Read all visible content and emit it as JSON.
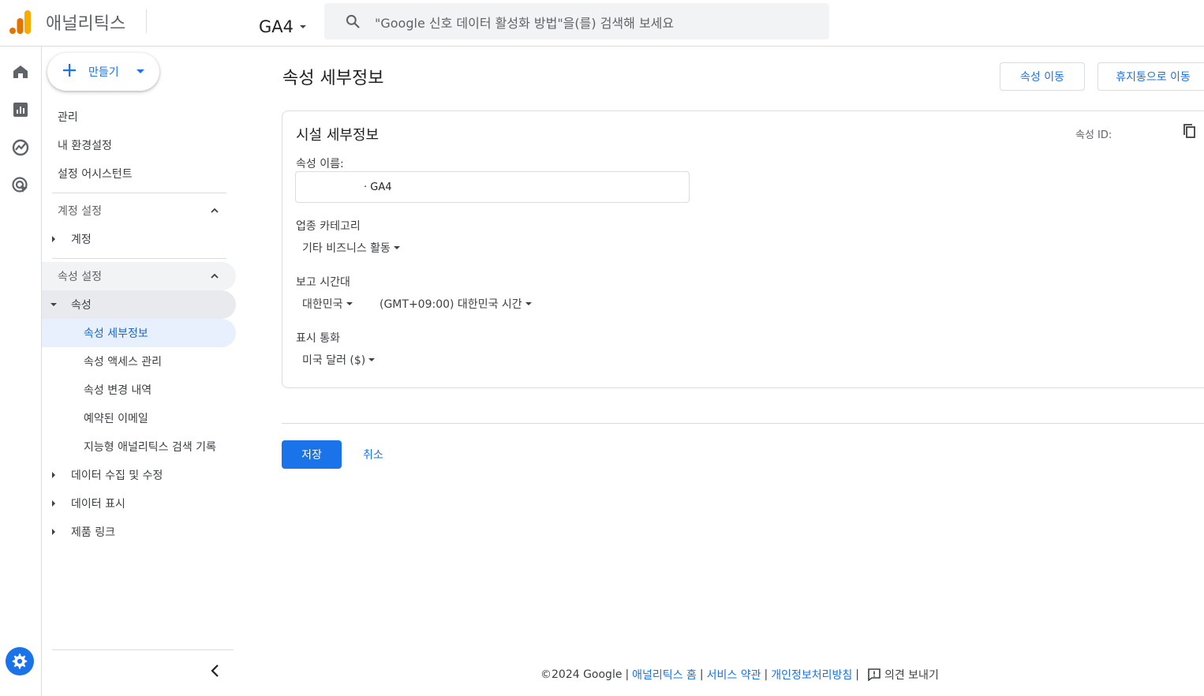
{
  "header": {
    "app_name": "애널리틱스",
    "property_name": "GA4",
    "search_placeholder": "\"Google 신호 데이터 활성화 방법\"을(를) 검색해 보세요"
  },
  "rail": {
    "items": [
      "home-icon",
      "reports-icon",
      "explore-icon",
      "advertising-icon"
    ],
    "settings": "gear-icon"
  },
  "sidenav": {
    "create_label": "만들기",
    "admin": "관리",
    "my_preferences": "내 환경설정",
    "setup_assistant": "설정 어시스턴트",
    "account_settings_header": "계정 설정",
    "account": "계정",
    "property_settings_header": "속성 설정",
    "property": "속성",
    "property_details": "속성 세부정보",
    "property_access": "속성 액세스 관리",
    "property_change_history": "속성 변경 내역",
    "scheduled_emails": "예약된 이메일",
    "analytics_search_history": "지능형 애널리틱스 검색 기록",
    "data_collection": "데이터 수집 및 수정",
    "data_display": "데이터 표시",
    "product_links": "제품 링크"
  },
  "main": {
    "page_title": "속성 세부정보",
    "move_property": "속성 이동",
    "move_to_trash": "휴지통으로 이동",
    "card_title": "시설 세부정보",
    "property_id_label": "속성 ID:",
    "property_name_label": "속성 이름:",
    "property_name_value": "· GA4",
    "industry_label": "업종 카테고리",
    "industry_value": "기타 비즈니스 활동",
    "timezone_label": "보고 시간대",
    "timezone_country": "대한민국",
    "timezone_value": "(GMT+09:00) 대한민국 시간",
    "currency_label": "표시 통화",
    "currency_value": "미국 달러 ($)",
    "save": "저장",
    "cancel": "취소"
  },
  "footer": {
    "copyright": "©2024 Google",
    "analytics_home": "애널리틱스 홈",
    "terms": "서비스 약관",
    "privacy": "개인정보처리방침",
    "feedback": "의견 보내기"
  },
  "colors": {
    "accent": "#1a73e8",
    "logo_orange": "#f9ab00",
    "logo_dark_orange": "#e37400"
  }
}
